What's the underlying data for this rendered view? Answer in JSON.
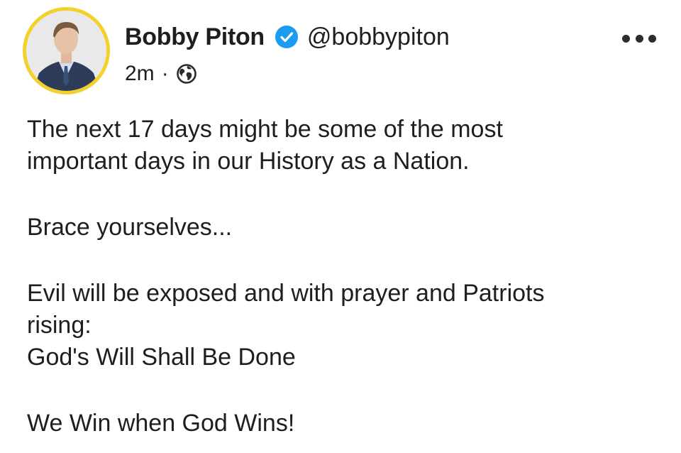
{
  "post": {
    "author_name": "Bobby Piton",
    "handle": "@bobbypiton",
    "timestamp": "2m",
    "separator": "·",
    "verified_icon": "verified-badge-icon",
    "audience_icon": "globe-icon",
    "more_icon": "more-options-icon",
    "colors": {
      "avatar_ring": "#f2d12a",
      "verified_badge": "#1d9bf0",
      "text": "#1c1e21"
    },
    "body": {
      "paragraphs": [
        [
          "The next 17 days might be some of the most",
          "important days in our History as a Nation."
        ],
        [
          "Brace yourselves..."
        ],
        [
          "Evil will be exposed and with prayer and Patriots",
          "rising:",
          "God's Will Shall Be Done"
        ],
        [
          "We Win when God Wins!"
        ]
      ]
    }
  }
}
